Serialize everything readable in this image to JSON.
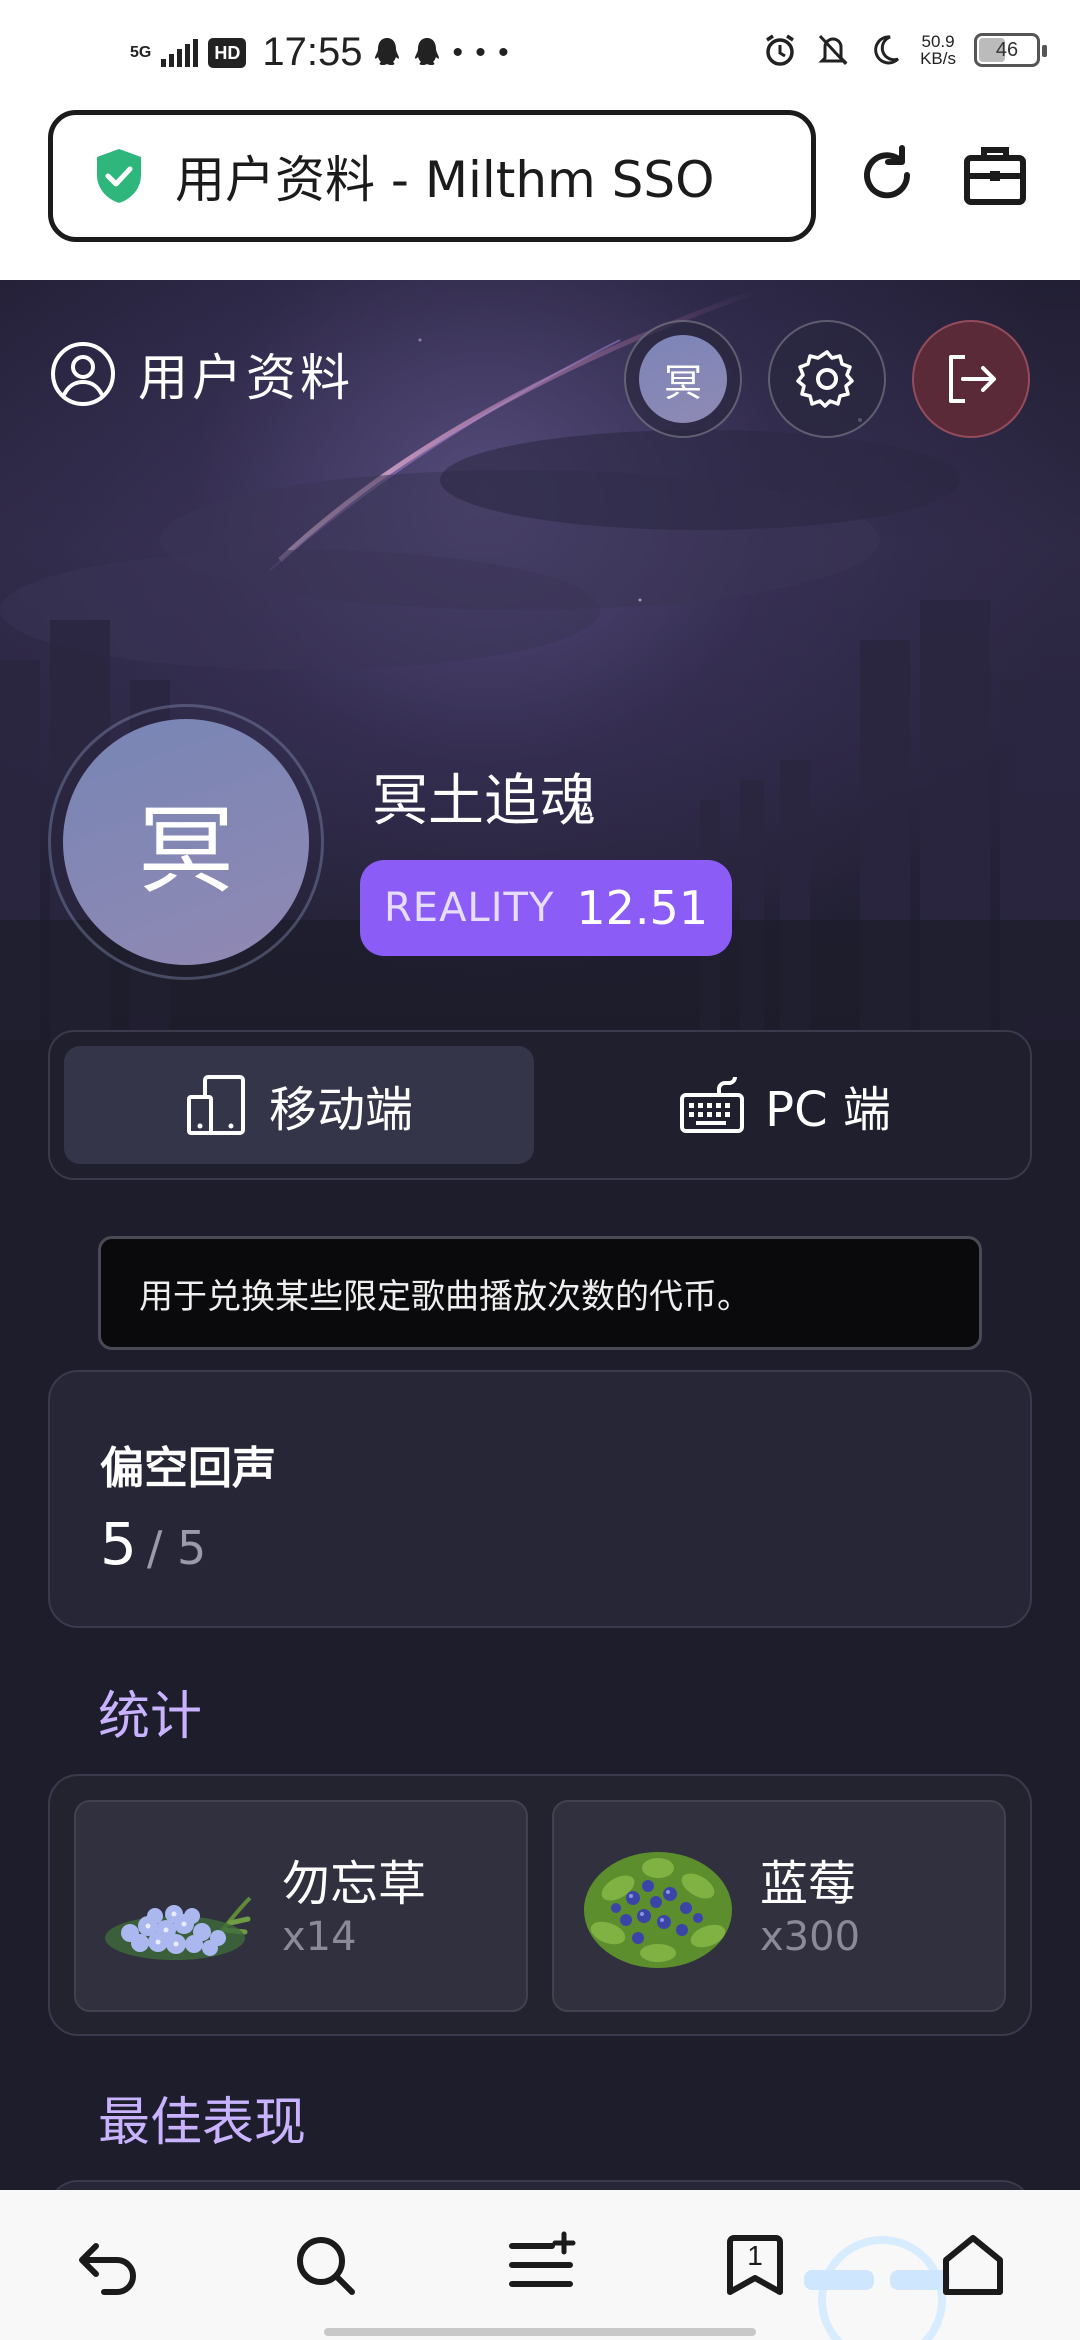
{
  "status_bar": {
    "network": "5G",
    "hd": "HD",
    "time": "17:55",
    "extra": "• • •",
    "speed_value": "50.9",
    "speed_unit": "KB/s",
    "battery": "46"
  },
  "browser": {
    "title": "用户资料 - Milthm SSO"
  },
  "header": {
    "title": "用户资料",
    "mini_avatar_char": "冥"
  },
  "profile": {
    "avatar_char": "冥",
    "username": "冥土追魂",
    "rating_label": "REALITY",
    "rating_value": "12.51"
  },
  "platform_tabs": [
    {
      "label": "移动端",
      "active": true
    },
    {
      "label": "PC 端",
      "active": false
    }
  ],
  "tooltip": {
    "text": "用于兑换某些限定歌曲播放次数的代币。"
  },
  "token": {
    "name": "偏空回声",
    "current": "5",
    "separator": "/ 5"
  },
  "stats": {
    "title": "统计",
    "items": [
      {
        "name": "勿忘草",
        "count": "x14"
      },
      {
        "name": "蓝莓",
        "count": "x300"
      }
    ]
  },
  "best": {
    "title": "最佳表现"
  },
  "bottom_nav": {
    "tab_count": "1"
  },
  "colors": {
    "accent": "#8b5cf6",
    "section_title": "#c9b2ff",
    "background": "#1d1d2b",
    "logout_bg": "#5a2a38",
    "shield": "#2fb67c"
  }
}
